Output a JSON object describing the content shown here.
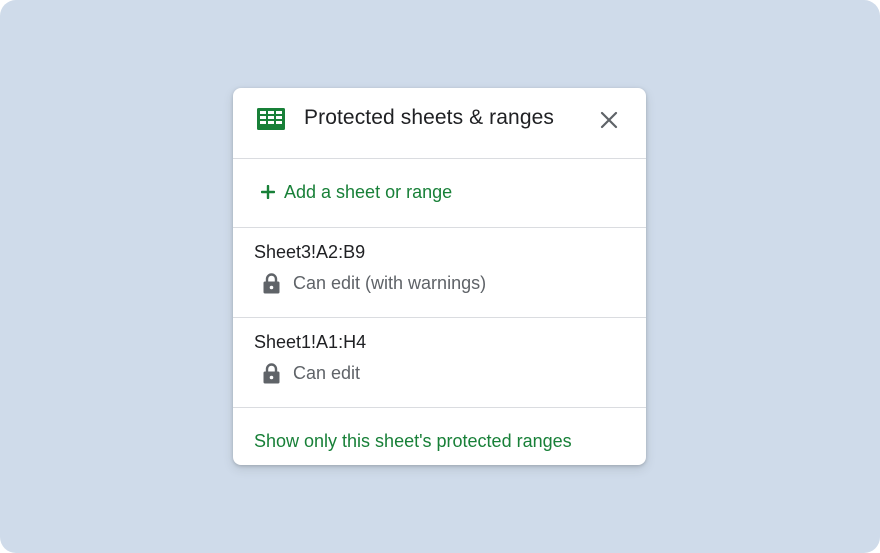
{
  "colors": {
    "background": "#cfdbea",
    "panel": "#ffffff",
    "accent_green": "#188038",
    "text_primary": "#202124",
    "text_secondary": "#5f6368",
    "divider": "#dadce0"
  },
  "panel": {
    "app_icon": "google-sheets-icon",
    "title": "Protected sheets & ranges",
    "close_icon": "close-icon"
  },
  "add_action": {
    "icon": "plus-icon",
    "label": "Add a sheet or range"
  },
  "ranges": [
    {
      "name": "Sheet3!A2:B9",
      "icon": "lock-icon",
      "permission": "Can edit (with warnings)"
    },
    {
      "name": "Sheet1!A1:H4",
      "icon": "lock-icon",
      "permission": "Can edit"
    }
  ],
  "footer": {
    "link_label": "Show only this sheet's protected ranges"
  }
}
